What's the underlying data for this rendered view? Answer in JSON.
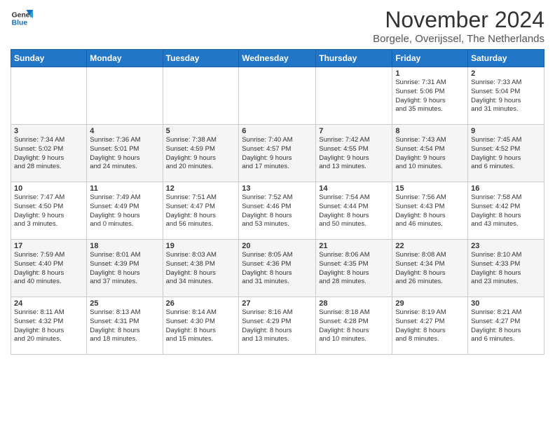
{
  "logo": {
    "line1": "General",
    "line2": "Blue"
  },
  "title": "November 2024",
  "subtitle": "Borgele, Overijssel, The Netherlands",
  "days_header": [
    "Sunday",
    "Monday",
    "Tuesday",
    "Wednesday",
    "Thursday",
    "Friday",
    "Saturday"
  ],
  "weeks": [
    [
      {
        "day": "",
        "detail": ""
      },
      {
        "day": "",
        "detail": ""
      },
      {
        "day": "",
        "detail": ""
      },
      {
        "day": "",
        "detail": ""
      },
      {
        "day": "",
        "detail": ""
      },
      {
        "day": "1",
        "detail": "Sunrise: 7:31 AM\nSunset: 5:06 PM\nDaylight: 9 hours\nand 35 minutes."
      },
      {
        "day": "2",
        "detail": "Sunrise: 7:33 AM\nSunset: 5:04 PM\nDaylight: 9 hours\nand 31 minutes."
      }
    ],
    [
      {
        "day": "3",
        "detail": "Sunrise: 7:34 AM\nSunset: 5:02 PM\nDaylight: 9 hours\nand 28 minutes."
      },
      {
        "day": "4",
        "detail": "Sunrise: 7:36 AM\nSunset: 5:01 PM\nDaylight: 9 hours\nand 24 minutes."
      },
      {
        "day": "5",
        "detail": "Sunrise: 7:38 AM\nSunset: 4:59 PM\nDaylight: 9 hours\nand 20 minutes."
      },
      {
        "day": "6",
        "detail": "Sunrise: 7:40 AM\nSunset: 4:57 PM\nDaylight: 9 hours\nand 17 minutes."
      },
      {
        "day": "7",
        "detail": "Sunrise: 7:42 AM\nSunset: 4:55 PM\nDaylight: 9 hours\nand 13 minutes."
      },
      {
        "day": "8",
        "detail": "Sunrise: 7:43 AM\nSunset: 4:54 PM\nDaylight: 9 hours\nand 10 minutes."
      },
      {
        "day": "9",
        "detail": "Sunrise: 7:45 AM\nSunset: 4:52 PM\nDaylight: 9 hours\nand 6 minutes."
      }
    ],
    [
      {
        "day": "10",
        "detail": "Sunrise: 7:47 AM\nSunset: 4:50 PM\nDaylight: 9 hours\nand 3 minutes."
      },
      {
        "day": "11",
        "detail": "Sunrise: 7:49 AM\nSunset: 4:49 PM\nDaylight: 9 hours\nand 0 minutes."
      },
      {
        "day": "12",
        "detail": "Sunrise: 7:51 AM\nSunset: 4:47 PM\nDaylight: 8 hours\nand 56 minutes."
      },
      {
        "day": "13",
        "detail": "Sunrise: 7:52 AM\nSunset: 4:46 PM\nDaylight: 8 hours\nand 53 minutes."
      },
      {
        "day": "14",
        "detail": "Sunrise: 7:54 AM\nSunset: 4:44 PM\nDaylight: 8 hours\nand 50 minutes."
      },
      {
        "day": "15",
        "detail": "Sunrise: 7:56 AM\nSunset: 4:43 PM\nDaylight: 8 hours\nand 46 minutes."
      },
      {
        "day": "16",
        "detail": "Sunrise: 7:58 AM\nSunset: 4:42 PM\nDaylight: 8 hours\nand 43 minutes."
      }
    ],
    [
      {
        "day": "17",
        "detail": "Sunrise: 7:59 AM\nSunset: 4:40 PM\nDaylight: 8 hours\nand 40 minutes."
      },
      {
        "day": "18",
        "detail": "Sunrise: 8:01 AM\nSunset: 4:39 PM\nDaylight: 8 hours\nand 37 minutes."
      },
      {
        "day": "19",
        "detail": "Sunrise: 8:03 AM\nSunset: 4:38 PM\nDaylight: 8 hours\nand 34 minutes."
      },
      {
        "day": "20",
        "detail": "Sunrise: 8:05 AM\nSunset: 4:36 PM\nDaylight: 8 hours\nand 31 minutes."
      },
      {
        "day": "21",
        "detail": "Sunrise: 8:06 AM\nSunset: 4:35 PM\nDaylight: 8 hours\nand 28 minutes."
      },
      {
        "day": "22",
        "detail": "Sunrise: 8:08 AM\nSunset: 4:34 PM\nDaylight: 8 hours\nand 26 minutes."
      },
      {
        "day": "23",
        "detail": "Sunrise: 8:10 AM\nSunset: 4:33 PM\nDaylight: 8 hours\nand 23 minutes."
      }
    ],
    [
      {
        "day": "24",
        "detail": "Sunrise: 8:11 AM\nSunset: 4:32 PM\nDaylight: 8 hours\nand 20 minutes."
      },
      {
        "day": "25",
        "detail": "Sunrise: 8:13 AM\nSunset: 4:31 PM\nDaylight: 8 hours\nand 18 minutes."
      },
      {
        "day": "26",
        "detail": "Sunrise: 8:14 AM\nSunset: 4:30 PM\nDaylight: 8 hours\nand 15 minutes."
      },
      {
        "day": "27",
        "detail": "Sunrise: 8:16 AM\nSunset: 4:29 PM\nDaylight: 8 hours\nand 13 minutes."
      },
      {
        "day": "28",
        "detail": "Sunrise: 8:18 AM\nSunset: 4:28 PM\nDaylight: 8 hours\nand 10 minutes."
      },
      {
        "day": "29",
        "detail": "Sunrise: 8:19 AM\nSunset: 4:27 PM\nDaylight: 8 hours\nand 8 minutes."
      },
      {
        "day": "30",
        "detail": "Sunrise: 8:21 AM\nSunset: 4:27 PM\nDaylight: 8 hours\nand 6 minutes."
      }
    ]
  ]
}
